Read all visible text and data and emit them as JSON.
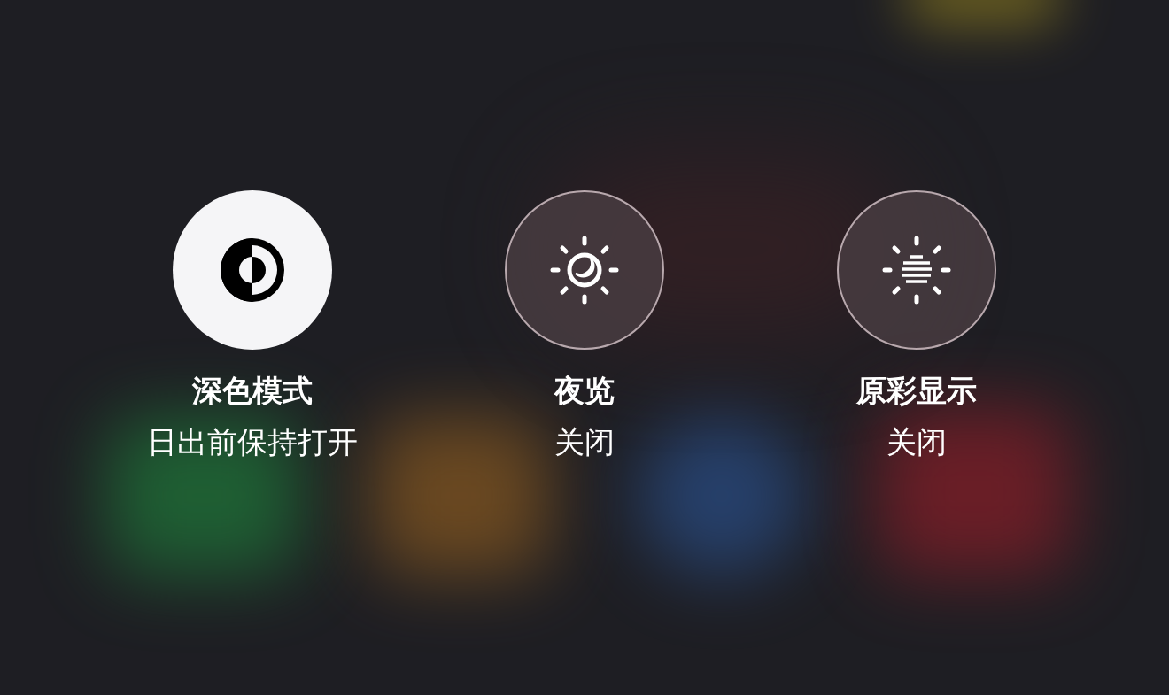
{
  "toggles": [
    {
      "kind": "contrast",
      "label": "深色模式",
      "status": "日出前保持打开",
      "on": true
    },
    {
      "kind": "sun-moon",
      "label": "夜览",
      "status": "关闭",
      "on": false
    },
    {
      "kind": "sun-stripes",
      "label": "原彩显示",
      "status": "关闭",
      "on": false
    }
  ]
}
